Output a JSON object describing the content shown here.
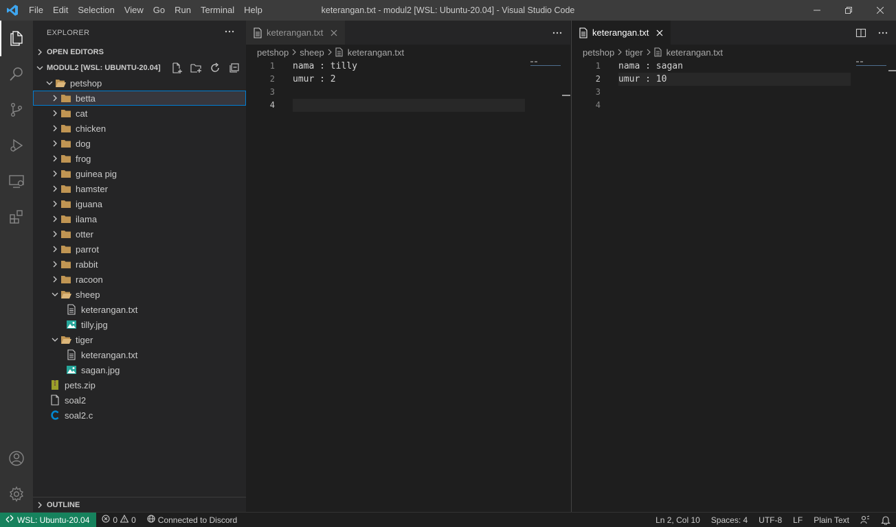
{
  "window": {
    "title": "keterangan.txt - modul2 [WSL: Ubuntu-20.04] - Visual Studio Code",
    "menu": [
      "File",
      "Edit",
      "Selection",
      "View",
      "Go",
      "Run",
      "Terminal",
      "Help"
    ]
  },
  "sidebar": {
    "header": "EXPLORER",
    "open_editors": "OPEN EDITORS",
    "workspace": "MODUL2 [WSL: UBUNTU-20.04]",
    "outline": "OUTLINE",
    "tree": [
      {
        "label": "petshop",
        "type": "folder-open",
        "depth": 1
      },
      {
        "label": "betta",
        "type": "folder",
        "depth": 2,
        "selected": true
      },
      {
        "label": "cat",
        "type": "folder",
        "depth": 2
      },
      {
        "label": "chicken",
        "type": "folder",
        "depth": 2
      },
      {
        "label": "dog",
        "type": "folder",
        "depth": 2
      },
      {
        "label": "frog",
        "type": "folder",
        "depth": 2
      },
      {
        "label": "guinea pig",
        "type": "folder",
        "depth": 2
      },
      {
        "label": "hamster",
        "type": "folder",
        "depth": 2
      },
      {
        "label": "iguana",
        "type": "folder",
        "depth": 2
      },
      {
        "label": "ilama",
        "type": "folder",
        "depth": 2
      },
      {
        "label": "otter",
        "type": "folder",
        "depth": 2
      },
      {
        "label": "parrot",
        "type": "folder",
        "depth": 2
      },
      {
        "label": "rabbit",
        "type": "folder",
        "depth": 2
      },
      {
        "label": "racoon",
        "type": "folder",
        "depth": 2
      },
      {
        "label": "sheep",
        "type": "folder-open",
        "depth": 2
      },
      {
        "label": "keterangan.txt",
        "type": "file-text",
        "depth": 3
      },
      {
        "label": "tilly.jpg",
        "type": "file-image",
        "depth": 3
      },
      {
        "label": "tiger",
        "type": "folder-open",
        "depth": 2
      },
      {
        "label": "keterangan.txt",
        "type": "file-text",
        "depth": 3
      },
      {
        "label": "sagan.jpg",
        "type": "file-image",
        "depth": 3
      },
      {
        "label": "pets.zip",
        "type": "file-zip",
        "depth": 1
      },
      {
        "label": "soal2",
        "type": "file",
        "depth": 1
      },
      {
        "label": "soal2.c",
        "type": "file-c",
        "depth": 1
      }
    ]
  },
  "editor1": {
    "tab": "keterangan.txt",
    "breadcrumb": [
      "petshop",
      "sheep",
      "keterangan.txt"
    ],
    "lines": [
      {
        "n": "1",
        "text": "nama : tilly"
      },
      {
        "n": "2",
        "text": "umur : 2"
      },
      {
        "n": "3",
        "text": ""
      },
      {
        "n": "4",
        "text": ""
      }
    ],
    "current_line": 4
  },
  "editor2": {
    "tab": "keterangan.txt",
    "breadcrumb": [
      "petshop",
      "tiger",
      "keterangan.txt"
    ],
    "lines": [
      {
        "n": "1",
        "text": "nama : sagan"
      },
      {
        "n": "2",
        "text": "umur : 10"
      },
      {
        "n": "3",
        "text": ""
      },
      {
        "n": "4",
        "text": ""
      }
    ],
    "current_line": 2
  },
  "status": {
    "remote": "WSL: Ubuntu-20.04",
    "errors": "0",
    "warnings": "0",
    "discord": "Connected to Discord",
    "position": "Ln 2, Col 10",
    "spaces": "Spaces: 4",
    "encoding": "UTF-8",
    "eol": "LF",
    "language": "Plain Text"
  },
  "colors": {
    "accent_blue": "#007acc",
    "remote_green": "#16825d",
    "folder": "#c09553",
    "image_icon": "#26a69a",
    "c_icon": "#0288d1"
  }
}
